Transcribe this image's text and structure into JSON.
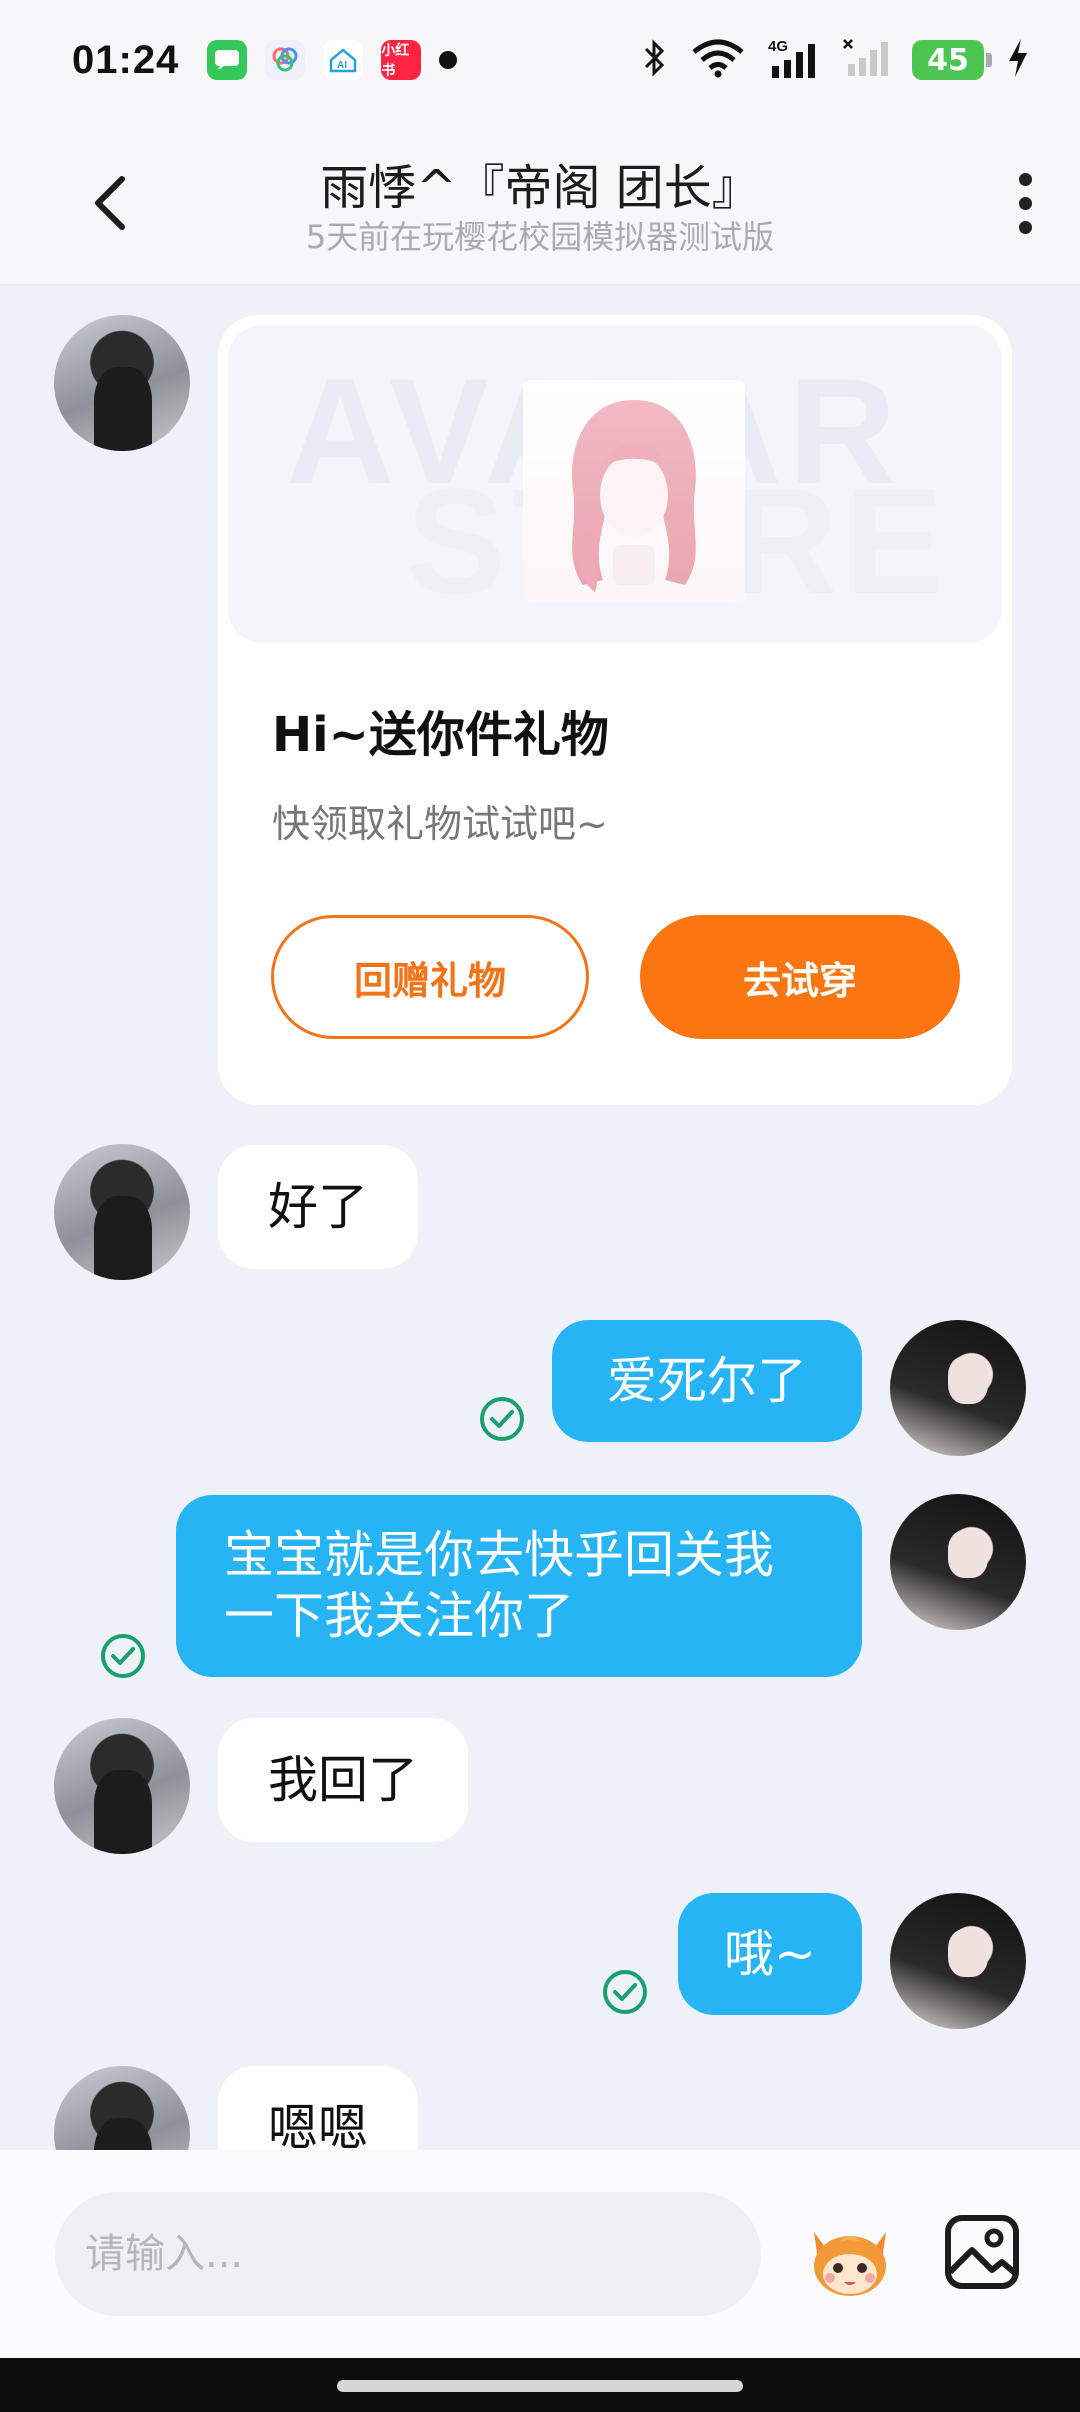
{
  "status_bar": {
    "time": "01:24",
    "apps": [
      {
        "icon": "messages-app-icon",
        "color": "#34c759"
      },
      {
        "icon": "photos-app-icon",
        "color": "#eaeafc"
      },
      {
        "icon": "ai-home-app-icon",
        "color": "#ffffff"
      },
      {
        "icon": "xiaohongshu-app-icon",
        "color": "#ff2442",
        "text": "小红书"
      }
    ],
    "network": "4G",
    "battery": "45"
  },
  "header": {
    "title": "雨悸^『帝阁 团长』",
    "subtitle": "5天前在玩樱花校园模拟器测试版"
  },
  "gift_card": {
    "banner_text_1": "AVATAR",
    "banner_text_2": "STORE",
    "title": "Hi~送你件礼物",
    "subtitle": "快领取礼物试试吧~",
    "return_gift_label": "回赠礼物",
    "try_on_label": "去试穿"
  },
  "messages": [
    {
      "side": "in",
      "text": "好了"
    },
    {
      "side": "out",
      "text": "爱死尔了",
      "read": true
    },
    {
      "side": "out",
      "text_line1": "宝宝就是你去快乎回关我",
      "text_line2": "一下我关注你了",
      "read": true
    },
    {
      "side": "in",
      "text": "我回了"
    },
    {
      "side": "out",
      "text": "哦~",
      "read": true
    },
    {
      "side": "in",
      "text": "嗯嗯"
    }
  ],
  "input": {
    "placeholder": "请输入..."
  },
  "colors": {
    "outgoing_bubble": "#27b4f5",
    "accent_orange": "#fb7510",
    "read_check": "#1aa06d"
  }
}
